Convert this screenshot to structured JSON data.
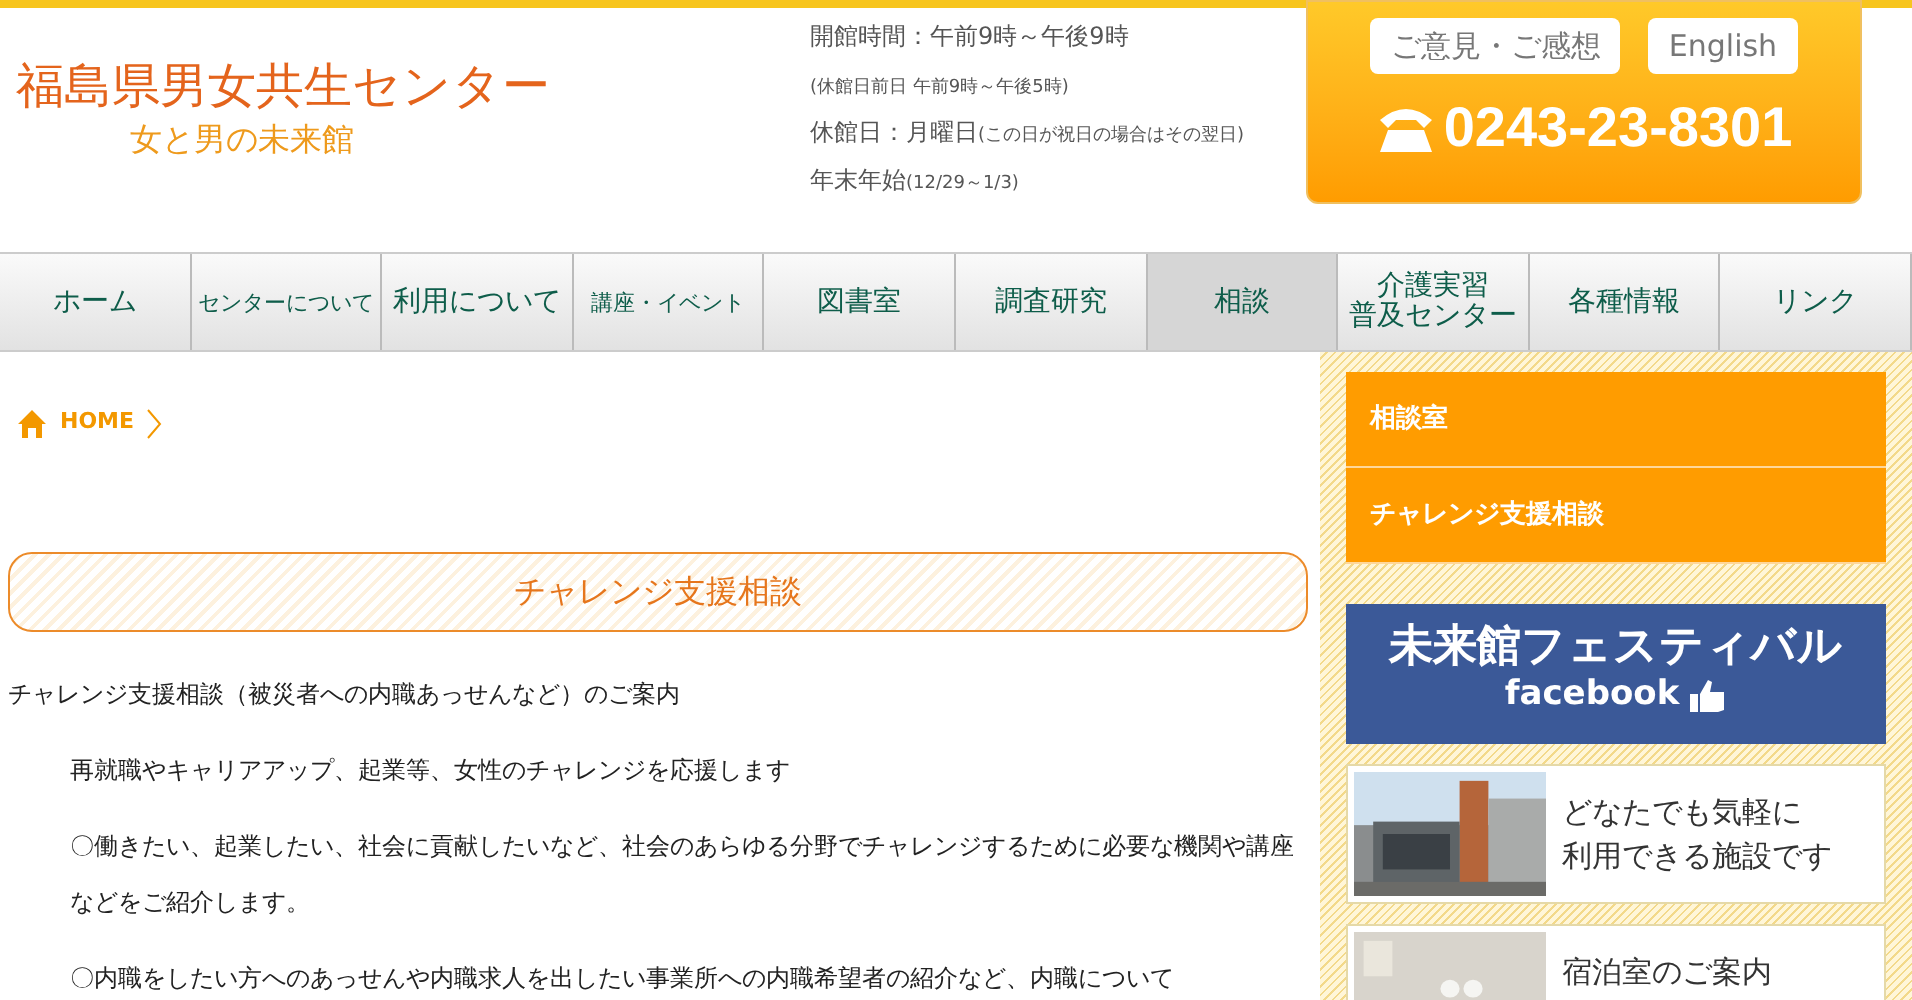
{
  "header": {
    "title": "福島県男女共生センター",
    "subtitle": "女と男の未来館",
    "hours": [
      {
        "note": "開館時間：午前9時～午後9時"
      },
      {
        "note": "(休館日前日 午前9時～午後5時)"
      },
      {
        "main": "休館日：月曜日",
        "note": "(この日が祝日の場合はその翌日)"
      },
      {
        "main": "年末年始",
        "note": "(12/29～1/3)"
      }
    ],
    "buttons": [
      "ご意見・ご感想",
      "English"
    ],
    "phone": "0243-23-8301"
  },
  "nav": [
    {
      "label": "ホーム",
      "selected": false
    },
    {
      "label": "センターについて",
      "selected": false
    },
    {
      "label": "利用について",
      "selected": false
    },
    {
      "label": "講座・イベント",
      "selected": false
    },
    {
      "label": "図書室",
      "selected": false
    },
    {
      "label": "調査研究",
      "selected": false
    },
    {
      "label": "相談",
      "selected": true
    },
    {
      "label": "介護実習",
      "label_line_2": "普及センター",
      "selected": false
    },
    {
      "label": "各種情報",
      "selected": false
    },
    {
      "label": "リンク",
      "selected": false
    }
  ],
  "breadcrumb": {
    "home": "HOME"
  },
  "page_title": "チャレンジ支援相談",
  "paragraphs": [
    {
      "text": "チャレンジ支援相談（被災者への内職あっせんなど）のご案内",
      "indent": false
    },
    {
      "text": "再就職やキャリアアップ、起業等、女性のチャレンジを応援します",
      "indent": true
    },
    {
      "text": "〇働きたい、起業したい、社会に貢献したいなど、社会のあらゆる分野でチャレンジするために必要な機関や講座などをご紹介します。",
      "indent": true
    },
    {
      "text": "〇内職をしたい方へのあっせんや内職求人を出したい事業所への内職希望者の紹介など、内職について",
      "indent": true
    }
  ],
  "sidebar": {
    "menu": [
      "相談室",
      "チャレンジ支援相談"
    ],
    "facebook_banner": {
      "title": "未来館フェスティバル",
      "brand": "facebook"
    },
    "banners": [
      {
        "text": "どなたでも気軽に",
        "text_line_2": "利用できる施設です",
        "kind": "picture"
      },
      {
        "text": "宿泊室のご案内",
        "kind": "picture"
      }
    ]
  }
}
